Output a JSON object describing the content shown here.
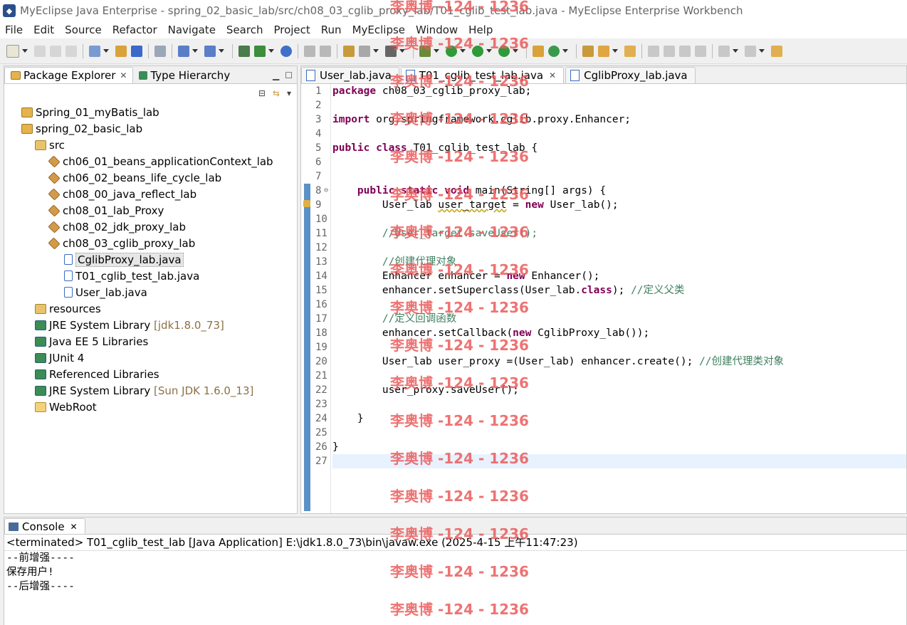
{
  "window": {
    "title": "MyEclipse Java Enterprise - spring_02_basic_lab/src/ch08_03_cglib_proxy_lab/T01_cglib_test_lab.java - MyEclipse Enterprise Workbench"
  },
  "menu": [
    "File",
    "Edit",
    "Source",
    "Refactor",
    "Navigate",
    "Search",
    "Project",
    "Run",
    "MyEclipse",
    "Window",
    "Help"
  ],
  "left_tabs": {
    "package_explorer": "Package Explorer",
    "type_hierarchy": "Type Hierarchy"
  },
  "tree": {
    "p1": "Spring_01_myBatis_lab",
    "p2": "spring_02_basic_lab",
    "src": "src",
    "pkg1": "ch06_01_beans_applicationContext_lab",
    "pkg2": "ch06_02_beans_life_cycle_lab",
    "pkg3": "ch08_00_java_reflect_lab",
    "pkg4": "ch08_01_lab_Proxy",
    "pkg5": "ch08_02_jdk_proxy_lab",
    "pkg6": "ch08_03_cglib_proxy_lab",
    "f1": "CglibProxy_lab.java",
    "f2": "T01_cglib_test_lab.java",
    "f3": "User_lab.java",
    "resources": "resources",
    "lib1": "JRE System Library",
    "lib1_ver": "[jdk1.8.0_73]",
    "lib2": "Java EE 5 Libraries",
    "lib3": "JUnit 4",
    "lib4": "Referenced Libraries",
    "lib5": "JRE System Library",
    "lib5_ver": "[Sun JDK 1.6.0_13]",
    "webroot": "WebRoot"
  },
  "editor_tabs": {
    "t1": "User_lab.java",
    "t2": "T01_cglib_test_lab.java",
    "t3": "CglibProxy_lab.java"
  },
  "code": {
    "l1a": "package",
    "l1b": " ch08_03_cglib_proxy_lab;",
    "l3a": "import",
    "l3b": " org.springframework.cglib.proxy.Enhancer;",
    "l5a": "public class",
    "l5b": " T01_cglib_test_lab {",
    "l8a": "public static void",
    "l8b": " main(String[] args) {",
    "l9a": "User_lab ",
    "l9b": "user_target",
    "l9c": " = ",
    "l9d": "new",
    "l9e": " User_lab();",
    "l11": "//User_target.saveUser();",
    "l13": "//创建代理对象",
    "l14a": "Enhancer enhancer = ",
    "l14b": "new",
    "l14c": " Enhancer();",
    "l15a": "enhancer.setSuperclass(User_lab.",
    "l15b": "class",
    "l15c": "); ",
    "l15d": "//定义父类",
    "l17": "//定义回调函数",
    "l18a": "enhancer.setCallback(",
    "l18b": "new",
    "l18c": " CglibProxy_lab());",
    "l20a": "User_lab user_proxy =(User_lab) enhancer.create(); ",
    "l20b": "//创建代理类对象",
    "l22": "user_proxy.saveUser();",
    "l24": "}",
    "l26": "}"
  },
  "line_numbers": [
    "1",
    "2",
    "3",
    "4",
    "5",
    "6",
    "7",
    "8",
    "9",
    "10",
    "11",
    "12",
    "13",
    "14",
    "15",
    "16",
    "17",
    "18",
    "19",
    "20",
    "21",
    "22",
    "23",
    "24",
    "25",
    "26",
    "27"
  ],
  "console": {
    "tab": "Console",
    "status": "<terminated> T01_cglib_test_lab [Java Application] E:\\jdk1.8.0_73\\bin\\javaw.exe (2025-4-15 上午11:47:23)",
    "out1": "--前增强----",
    "out2": "保存用户!",
    "out3": "--后增强----"
  },
  "watermark": "李奥博 -124 - 1236",
  "colors": {
    "keyword": "#7f0055",
    "comment": "#3f7f5f",
    "watermark": "#eb5a5a"
  }
}
